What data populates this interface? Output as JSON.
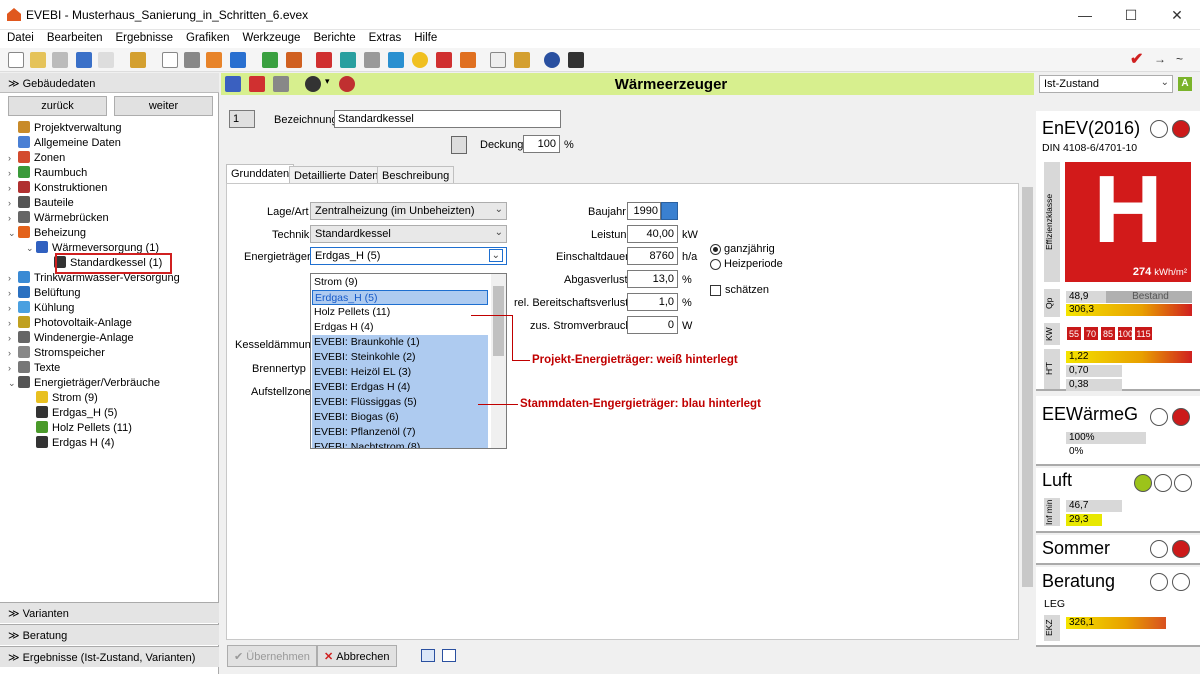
{
  "window": {
    "title": "EVEBI - Musterhaus_Sanierung_in_Schritten_6.evex",
    "minimize": "—",
    "maximize": "☐",
    "close": "✕"
  },
  "menu": [
    "Datei",
    "Bearbeiten",
    "Ergebnisse",
    "Grafiken",
    "Werkzeuge",
    "Berichte",
    "Extras",
    "Hilfe"
  ],
  "left": {
    "header": "Gebäudedaten",
    "back": "zurück",
    "forward": "weiter",
    "tree": [
      {
        "label": "Projektverwaltung",
        "level": 1,
        "toggle": "",
        "icon": "folder-gear-icon",
        "color": "#c88b2a"
      },
      {
        "label": "Allgemeine Daten",
        "level": 1,
        "toggle": "",
        "icon": "document-icon",
        "color": "#4a7fd4"
      },
      {
        "label": "Zonen",
        "level": 1,
        "toggle": "›",
        "icon": "house-icon",
        "color": "#d34b2e"
      },
      {
        "label": "Raumbuch",
        "level": 1,
        "toggle": "›",
        "icon": "book-icon",
        "color": "#3a9a3a"
      },
      {
        "label": "Konstruktionen",
        "level": 1,
        "toggle": "›",
        "icon": "wall-icon",
        "color": "#b03030"
      },
      {
        "label": "Bauteile",
        "level": 1,
        "toggle": "›",
        "icon": "house-part-icon",
        "color": "#555"
      },
      {
        "label": "Wärmebrücken",
        "level": 1,
        "toggle": "›",
        "icon": "bridge-icon",
        "color": "#666"
      },
      {
        "label": "Beheizung",
        "level": 1,
        "toggle": "⌄",
        "icon": "flame-house-icon",
        "color": "#e3621b"
      },
      {
        "label": "Wärmeversorgung (1)",
        "level": 2,
        "toggle": "⌄",
        "icon": "heating-icon",
        "color": "#3060c0"
      },
      {
        "label": "Standardkessel (1)",
        "level": 3,
        "toggle": "",
        "icon": "boiler-icon",
        "color": "#333"
      },
      {
        "label": "Trinkwarmwasser-Versorgung",
        "level": 1,
        "toggle": "›",
        "icon": "water-drop-icon",
        "color": "#3a8ad4"
      },
      {
        "label": "Belüftung",
        "level": 1,
        "toggle": "›",
        "icon": "fan-icon",
        "color": "#2a70c0"
      },
      {
        "label": "Kühlung",
        "level": 1,
        "toggle": "›",
        "icon": "snowflake-icon",
        "color": "#4aa0e0"
      },
      {
        "label": "Photovoltaik-Anlage",
        "level": 1,
        "toggle": "›",
        "icon": "solar-panel-icon",
        "color": "#c0a020"
      },
      {
        "label": "Windenergie-Anlage",
        "level": 1,
        "toggle": "›",
        "icon": "wind-turbine-icon",
        "color": "#666"
      },
      {
        "label": "Stromspeicher",
        "level": 1,
        "toggle": "›",
        "icon": "battery-icon",
        "color": "#888"
      },
      {
        "label": "Texte",
        "level": 1,
        "toggle": "›",
        "icon": "text-icon",
        "color": "#777"
      },
      {
        "label": "Energieträger/Verbräuche",
        "level": 1,
        "toggle": "⌄",
        "icon": "energy-icon",
        "color": "#555"
      },
      {
        "label": "Strom (9)",
        "level": 2,
        "toggle": "",
        "icon": "lightning-icon",
        "color": "#e8c020"
      },
      {
        "label": "Erdgas_H (5)",
        "level": 2,
        "toggle": "",
        "icon": "gas-flame-icon",
        "color": "#333"
      },
      {
        "label": "Holz Pellets (11)",
        "level": 2,
        "toggle": "",
        "icon": "tree-icon",
        "color": "#4a9a2a"
      },
      {
        "label": "Erdgas H (4)",
        "level": 2,
        "toggle": "",
        "icon": "gas-flame-icon",
        "color": "#333"
      }
    ],
    "accordion": [
      "Varianten",
      "Beratung",
      "Ergebnisse (Ist-Zustand, Varianten)"
    ]
  },
  "main": {
    "title": "Wärmeerzeuger",
    "number": "1",
    "bezeichnung_label": "Bezeichnung",
    "bezeichnung": "Standardkessel",
    "deckung_label": "Deckung",
    "deckung": "100",
    "deckung_unit": "%",
    "tabs": [
      "Grunddaten",
      "Detaillierte Daten",
      "Beschreibung"
    ],
    "lage_label": "Lage/Art",
    "lage": "Zentralheizung (im Unbeheizten)",
    "technik_label": "Technik",
    "technik": "Standardkessel",
    "energietraeger_label": "Energieträger",
    "energietraeger": "Erdgas_H (5)",
    "kesseldaemmung_label": "Kesseldämmung",
    "brennertyp_label": "Brennertyp",
    "aufstellzone_label": "Aufstellzone",
    "dropdown": [
      {
        "label": "Strom (9)",
        "kind": "project"
      },
      {
        "label": "Erdgas_H (5)",
        "kind": "selected"
      },
      {
        "label": "Holz Pellets (11)",
        "kind": "project"
      },
      {
        "label": "Erdgas H (4)",
        "kind": "project"
      },
      {
        "label": "EVEBI: Braunkohle (1)",
        "kind": "master"
      },
      {
        "label": "EVEBI: Steinkohle (2)",
        "kind": "master"
      },
      {
        "label": "EVEBI: Heizöl EL (3)",
        "kind": "master"
      },
      {
        "label": "EVEBI: Erdgas H (4)",
        "kind": "master"
      },
      {
        "label": "EVEBI: Flüssiggas (5)",
        "kind": "master"
      },
      {
        "label": "EVEBI: Biogas (6)",
        "kind": "master"
      },
      {
        "label": "EVEBI: Pflanzenöl (7)",
        "kind": "master"
      },
      {
        "label": "EVEBI: Nachtstrom (8)",
        "kind": "master"
      }
    ],
    "baujahr_label": "Baujahr",
    "baujahr": "1990",
    "leistung_label": "Leistung",
    "leistung": "40,00",
    "leistung_unit": "kW",
    "einschalt_label": "Einschaltdauer",
    "einschalt": "8760",
    "einschalt_unit": "h/a",
    "abgas_label": "Abgasverlust",
    "abgas": "13,0",
    "abgas_unit": "%",
    "bereit_label": "rel. Bereitschaftsverlust",
    "bereit": "1,0",
    "bereit_unit": "%",
    "strom_label": "zus. Stromverbrauch",
    "strom": "0",
    "strom_unit": "W",
    "radio1": "ganzjährig",
    "radio2": "Heizperiode",
    "schaetzen": "schätzen",
    "annotation1": "Projekt-Energieträger: weiß hinterlegt",
    "annotation2": "Stammdaten-Engergieträger: blau hinterlegt",
    "btn_apply": "Übernehmen",
    "btn_cancel": "Abbrechen"
  },
  "right": {
    "state": "Ist-Zustand",
    "enev": "EnEV(2016)",
    "din": "DIN 4108-6/4701-10",
    "effizienz": "Effizienzklasse",
    "klasse": "H",
    "kwh": "274",
    "kwh_unit": "kWh/m²",
    "qp_label": "Qp",
    "qp1": "48,9",
    "bestand": "Bestand",
    "qp2": "306,3",
    "kw_label": "KW",
    "kw": [
      "55",
      "70",
      "85",
      "100",
      "115"
    ],
    "ht_label": "H'T",
    "ht1": "1,22",
    "ht2": "0,70",
    "ht3": "0,38",
    "ee": "EEWärmeG",
    "ee1": "100%",
    "ee2": "0%",
    "luft": "Luft",
    "inf_label": "Inf min",
    "luft1": "46,7",
    "luft2": "29,3",
    "sommer": "Sommer",
    "beratung": "Beratung",
    "leg": "LEG",
    "ekz_label": "EKZ",
    "ekz": "326,1",
    "colors": {
      "green": "#9cc31a",
      "red": "#cc1a1a",
      "accent": "#d7ef8e"
    }
  }
}
